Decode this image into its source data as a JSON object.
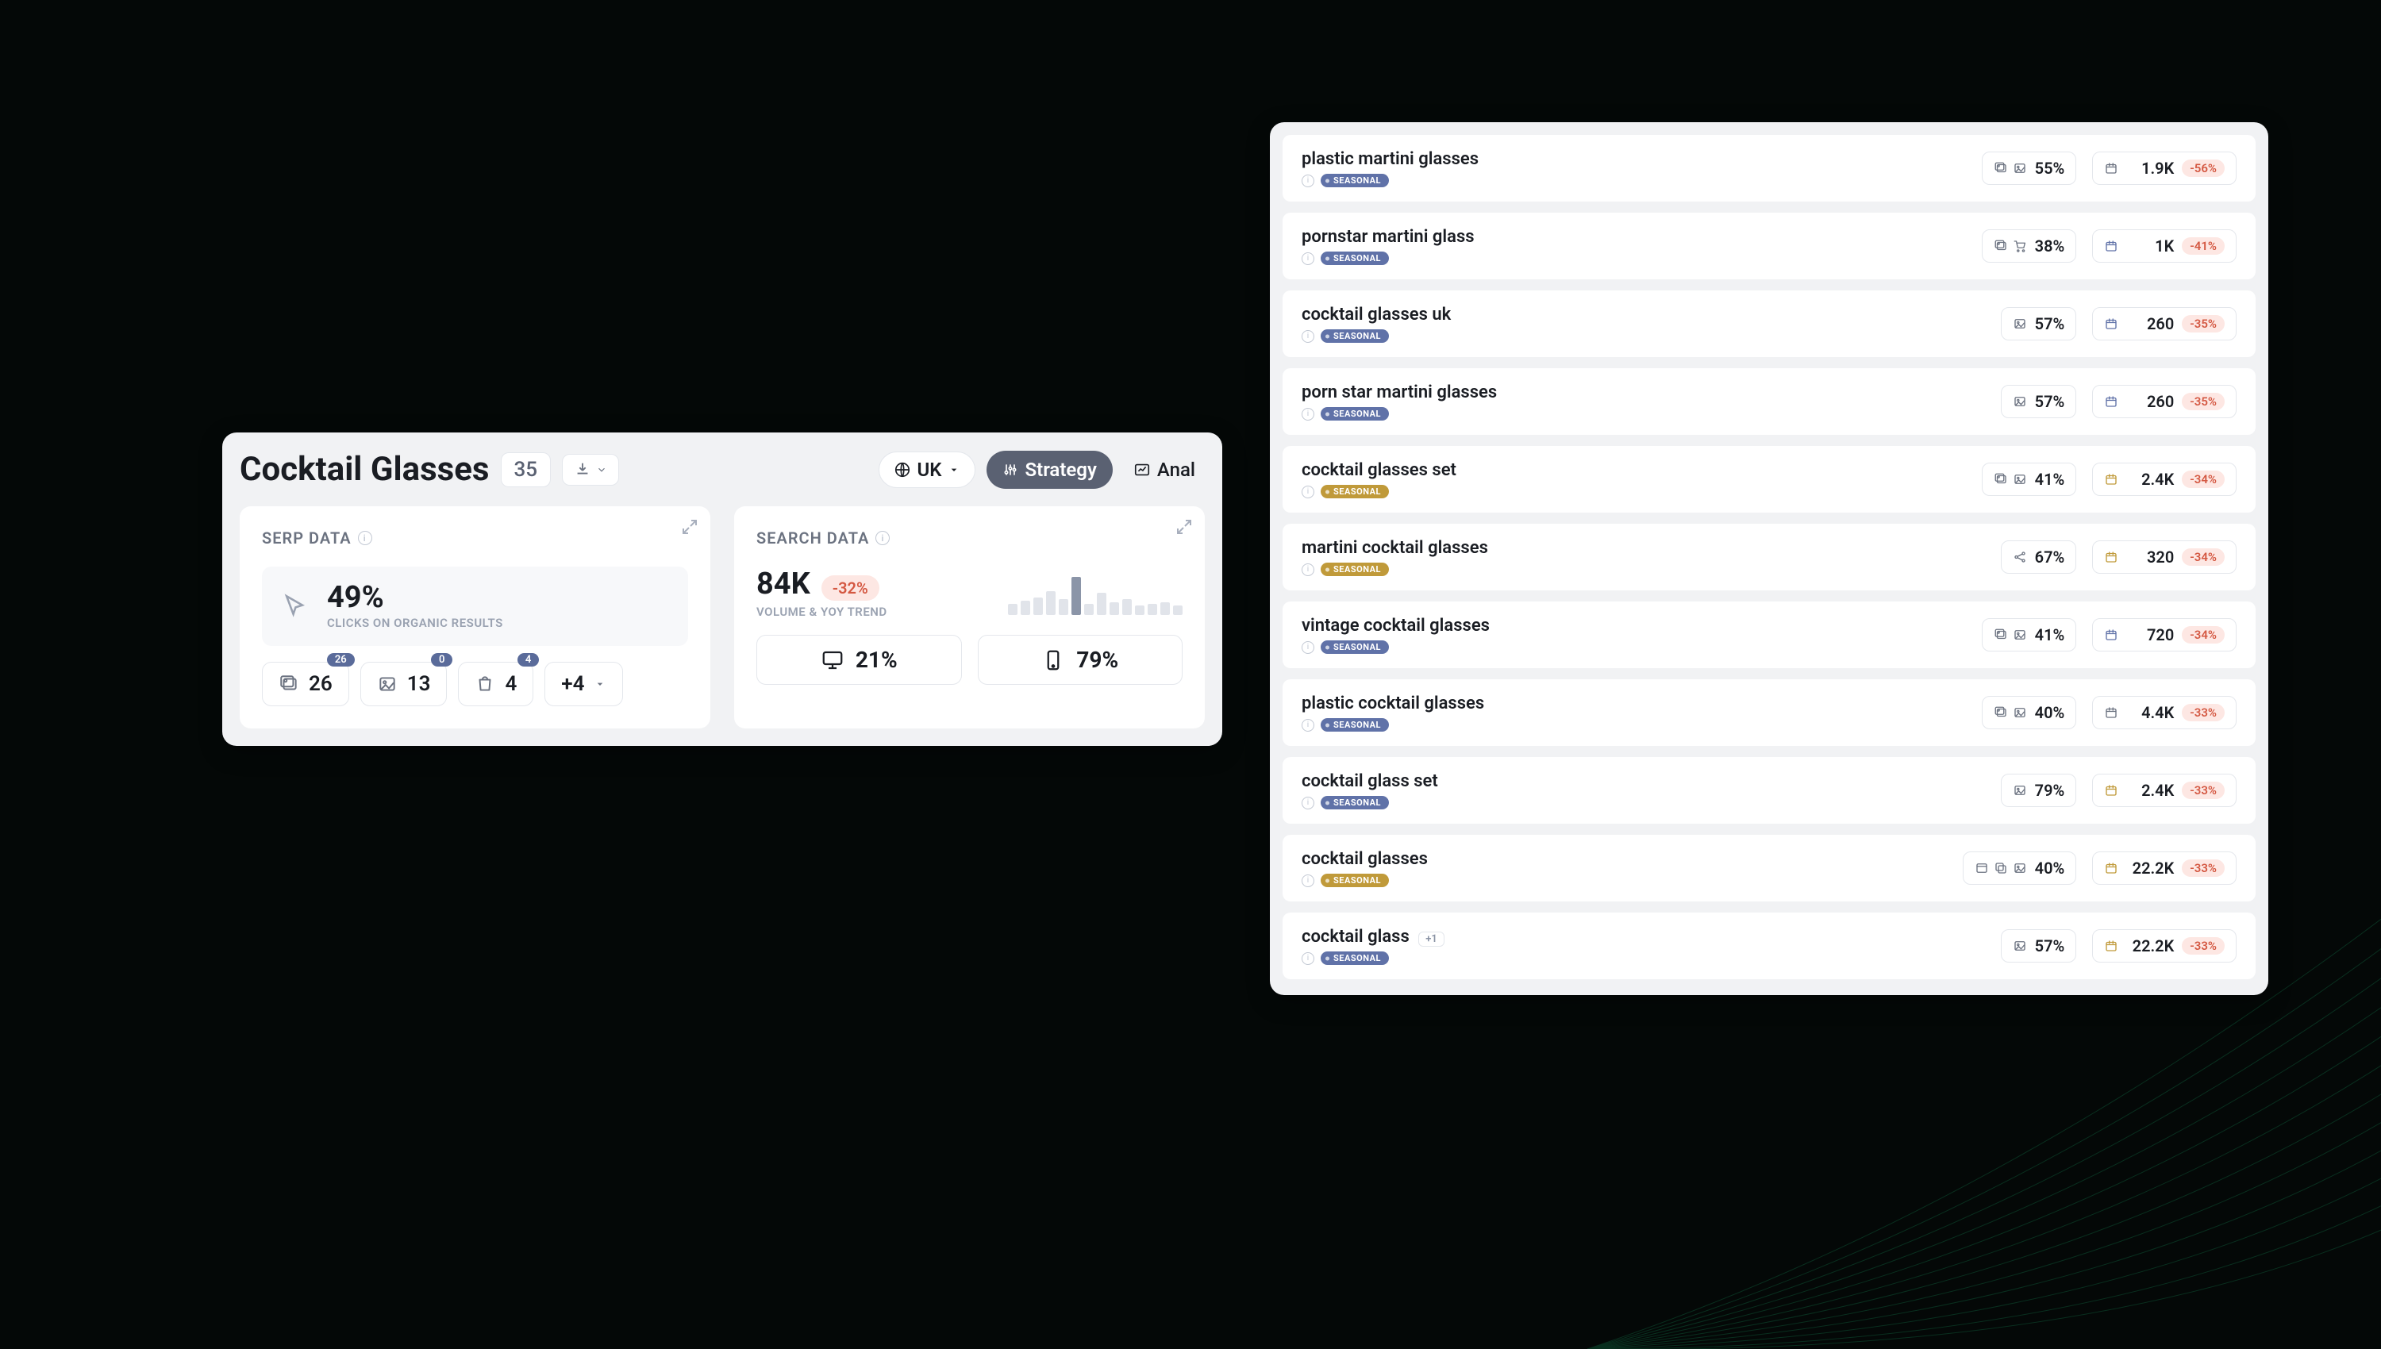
{
  "leftPanel": {
    "title": "Cocktail Glasses",
    "count": "35",
    "region": "UK",
    "strategyLabel": "Strategy",
    "analLabel": "Anal",
    "serp": {
      "title": "SERP DATA",
      "bigValue": "49%",
      "subLabel": "CLICKS ON ORGANIC RESULTS",
      "features": [
        {
          "icon": "images",
          "value": "26",
          "badge": "26"
        },
        {
          "icon": "image",
          "value": "13",
          "badge": "0"
        },
        {
          "icon": "shopping",
          "value": "4",
          "badge": "4"
        }
      ],
      "moreLabel": "+4"
    },
    "search": {
      "title": "SEARCH DATA",
      "bigValue": "84K",
      "delta": "-32%",
      "subLabel": "VOLUME & YOY TREND",
      "desktop": "21%",
      "mobile": "79%"
    }
  },
  "keywords": [
    {
      "term": "plastic martini glasses",
      "seasonal": "blue",
      "icons": [
        "images",
        "image"
      ],
      "pct": "55%",
      "cal": "plain",
      "vol": "1.9K",
      "delta": "-56%"
    },
    {
      "term": "pornstar martini glass",
      "seasonal": "blue",
      "icons": [
        "images",
        "cart"
      ],
      "pct": "38%",
      "cal": "blue",
      "vol": "1K",
      "delta": "-41%"
    },
    {
      "term": "cocktail glasses uk",
      "seasonal": "blue",
      "icons": [
        "image"
      ],
      "pct": "57%",
      "cal": "blue",
      "vol": "260",
      "delta": "-35%"
    },
    {
      "term": "porn star martini glasses",
      "seasonal": "blue",
      "icons": [
        "image"
      ],
      "pct": "57%",
      "cal": "blue",
      "vol": "260",
      "delta": "-35%"
    },
    {
      "term": "cocktail glasses set",
      "seasonal": "gold",
      "icons": [
        "images",
        "image"
      ],
      "pct": "41%",
      "cal": "gold",
      "vol": "2.4K",
      "delta": "-34%"
    },
    {
      "term": "martini cocktail glasses",
      "seasonal": "gold",
      "icons": [
        "share"
      ],
      "pct": "67%",
      "cal": "gold",
      "vol": "320",
      "delta": "-34%"
    },
    {
      "term": "vintage cocktail glasses",
      "seasonal": "blue",
      "icons": [
        "images",
        "image"
      ],
      "pct": "41%",
      "cal": "blue",
      "vol": "720",
      "delta": "-34%"
    },
    {
      "term": "plastic cocktail glasses",
      "seasonal": "blue",
      "icons": [
        "images",
        "image"
      ],
      "pct": "40%",
      "cal": "plain",
      "vol": "4.4K",
      "delta": "-33%"
    },
    {
      "term": "cocktail glass set",
      "seasonal": "blue",
      "icons": [
        "image"
      ],
      "pct": "79%",
      "cal": "gold",
      "vol": "2.4K",
      "delta": "-33%"
    },
    {
      "term": "cocktail glasses",
      "seasonal": "gold",
      "icons": [
        "window",
        "copy",
        "image"
      ],
      "pct": "40%",
      "cal": "gold",
      "vol": "22.2K",
      "delta": "-33%"
    },
    {
      "term": "cocktail glass",
      "seasonal": "blue",
      "plus": "+1",
      "icons": [
        "image"
      ],
      "pct": "57%",
      "cal": "gold",
      "vol": "22.2K",
      "delta": "-33%"
    }
  ],
  "seasonalLabel": "SEASONAL",
  "sparkHeights": [
    14,
    18,
    22,
    30,
    20,
    48,
    14,
    28,
    16,
    20,
    12,
    14,
    16,
    12
  ]
}
